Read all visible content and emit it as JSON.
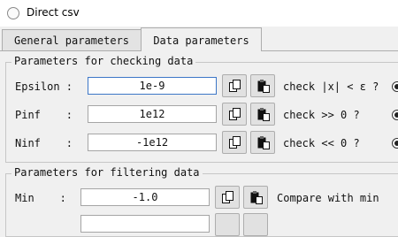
{
  "window": {
    "title": "Direct csv",
    "icon": "app-circle-icon"
  },
  "tabs": [
    {
      "label": "General parameters",
      "active": false
    },
    {
      "label": "Data parameters",
      "active": true
    }
  ],
  "check_group": {
    "title": "Parameters for checking data",
    "rows": [
      {
        "label": "Epsilon :",
        "value": "1e-9",
        "description": "check |x| < ε ?"
      },
      {
        "label": "Pinf    :",
        "value": "1e12",
        "description": "check >> 0 ?"
      },
      {
        "label": "Ninf    :",
        "value": "-1e12",
        "description": "check << 0 ?"
      }
    ]
  },
  "filter_group": {
    "title": "Parameters for filtering data",
    "rows": [
      {
        "label": "Min    :",
        "value": "-1.0",
        "description": "Compare with min"
      }
    ]
  },
  "icons": {
    "copy": "copy-icon",
    "paste": "paste-icon"
  }
}
